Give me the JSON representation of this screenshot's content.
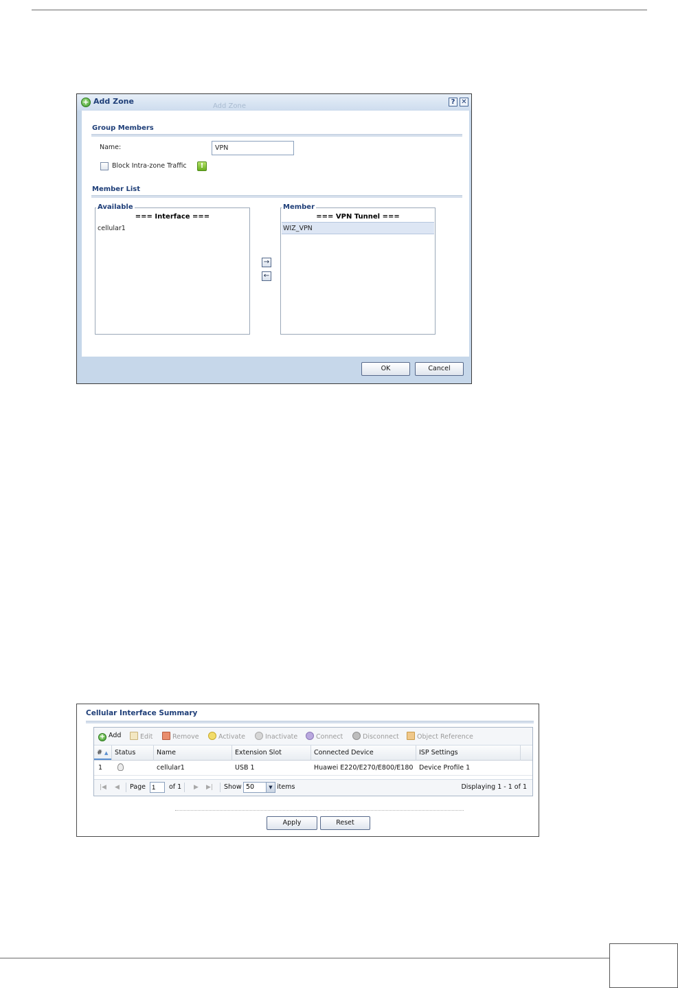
{
  "add_zone_dialog": {
    "title": "Add Zone",
    "ghost_title": "Add Zone",
    "help_label": "?",
    "close_label": "✕",
    "group_members": {
      "header": "Group Members",
      "name_label": "Name:",
      "name_value": "VPN",
      "block_label": "Block Intra-zone Traffic",
      "block_checked": false,
      "info_glyph": "!"
    },
    "member_list": {
      "header": "Member List",
      "available": {
        "legend": "Available",
        "group_heading": "=== Interface ===",
        "items": [
          "cellular1"
        ]
      },
      "member": {
        "legend": "Member",
        "group_heading": "=== VPN Tunnel ===",
        "items": [
          "WIZ_VPN"
        ],
        "selected_index": 0
      },
      "move_right": "→",
      "move_left": "←"
    },
    "ok_label": "OK",
    "cancel_label": "Cancel"
  },
  "cellular_summary": {
    "title": "Cellular Interface Summary",
    "toolbar": [
      {
        "label": "Add",
        "icon": "add-icon",
        "enabled": true
      },
      {
        "label": "Edit",
        "icon": "edit-icon",
        "enabled": false
      },
      {
        "label": "Remove",
        "icon": "remove-icon",
        "enabled": false
      },
      {
        "label": "Activate",
        "icon": "activate-icon",
        "enabled": false
      },
      {
        "label": "Inactivate",
        "icon": "inactivate-icon",
        "enabled": false
      },
      {
        "label": "Connect",
        "icon": "connect-icon",
        "enabled": false
      },
      {
        "label": "Disconnect",
        "icon": "disconnect-icon",
        "enabled": false
      },
      {
        "label": "Object Reference",
        "icon": "object-reference-icon",
        "enabled": false
      }
    ],
    "columns": [
      "#",
      "Status",
      "Name",
      "Extension Slot",
      "Connected Device",
      "ISP Settings"
    ],
    "rows": [
      {
        "num": "1",
        "status_icon": "lightbulb-icon",
        "name": "cellular1",
        "slot": "USB 1",
        "device": "Huawei E220/E270/E800/E180",
        "isp": "Device Profile 1"
      }
    ],
    "pager": {
      "page_label": "Page",
      "page_value": "1",
      "of_label": "of 1",
      "show_label": "Show",
      "show_value": "50",
      "items_label": "items",
      "displaying": "Displaying 1 - 1 of 1"
    },
    "apply_label": "Apply",
    "reset_label": "Reset"
  }
}
